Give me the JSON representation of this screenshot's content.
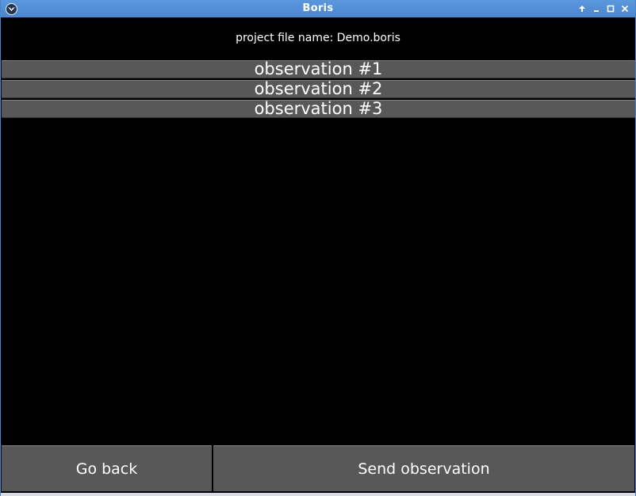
{
  "window": {
    "title": "Boris",
    "controls": [
      "keep-above",
      "minimize",
      "maximize",
      "close"
    ]
  },
  "project": {
    "label": "project file name: Demo.boris"
  },
  "observations": [
    {
      "label": "observation #1"
    },
    {
      "label": "observation #2"
    },
    {
      "label": "observation #3"
    }
  ],
  "buttons": {
    "back": "Go back",
    "send": "Send observation"
  },
  "colors": {
    "titlebar": "#4b86cf",
    "background": "#000000",
    "button": "#585858",
    "text": "#ffffff"
  }
}
